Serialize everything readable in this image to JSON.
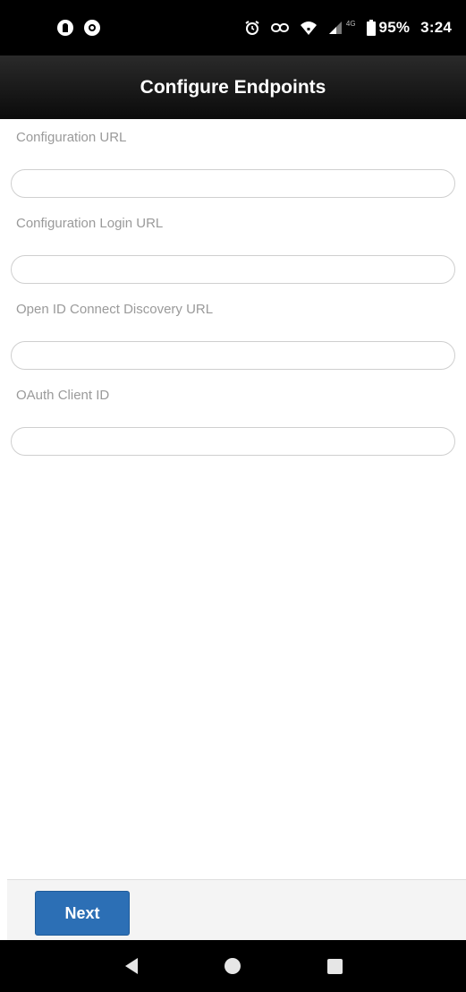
{
  "status_bar": {
    "battery": "95%",
    "time": "3:24",
    "network": "4G",
    "icons_left": [
      "pi-icon",
      "shield-icon"
    ],
    "icons_right": [
      "alarm-icon",
      "link-icon",
      "wifi-icon",
      "signal-icon",
      "battery-icon"
    ]
  },
  "header": {
    "title": "Configure Endpoints"
  },
  "form": {
    "fields": [
      {
        "label": "Configuration URL",
        "value": "",
        "placeholder": ""
      },
      {
        "label": "Configuration Login URL",
        "value": "",
        "placeholder": ""
      },
      {
        "label": "Open ID Connect Discovery URL",
        "value": "",
        "placeholder": ""
      },
      {
        "label": "OAuth Client ID",
        "value": "",
        "placeholder": ""
      }
    ]
  },
  "footer": {
    "next_label": "Next"
  },
  "nav": {
    "icons": [
      "back-icon",
      "home-icon",
      "recents-icon"
    ]
  },
  "colors": {
    "accent": "#2c6fb5",
    "header_bg": "#111111",
    "label_text": "#9a9a9a"
  }
}
